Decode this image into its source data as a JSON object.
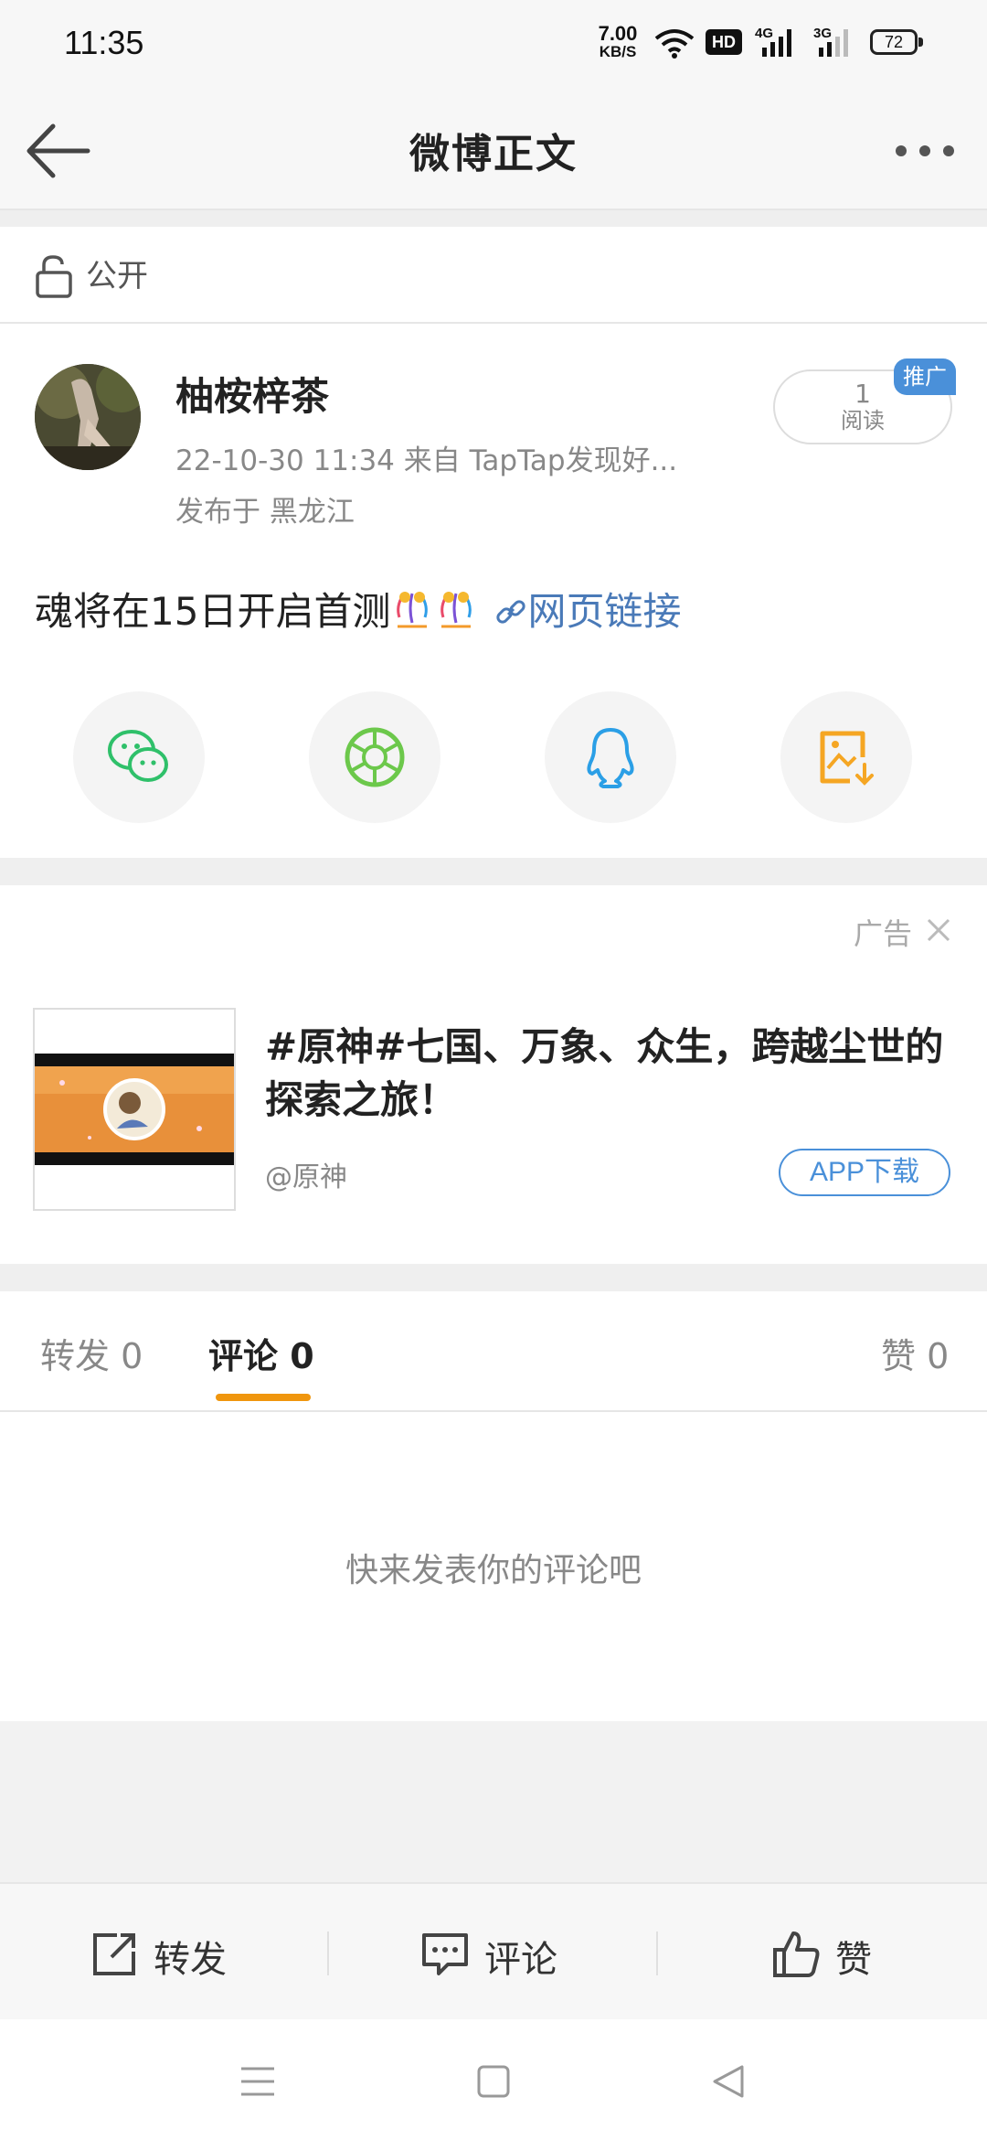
{
  "status_bar": {
    "time": "11:35",
    "net_speed_value": "7.00",
    "net_speed_unit": "KB/S",
    "hd_badge": "HD",
    "sig1_label": "4G",
    "sig2_label": "3G",
    "battery": "72"
  },
  "nav": {
    "title": "微博正文",
    "back_icon": "arrow-left-icon",
    "more_icon": "more-dots-icon"
  },
  "visibility": {
    "label": "公开"
  },
  "post": {
    "username": "柚桉梓茶",
    "meta": "22-10-30 11:34  来自 TapTap发现好...",
    "location": "发布于 黑龙江",
    "read_count": "1",
    "read_label": "阅读",
    "promo_tag": "推广",
    "text": "魂将在15日开启首测",
    "link_text": "网页链接"
  },
  "share": {
    "wechat_icon": "wechat-icon",
    "moments_icon": "moments-icon",
    "qq_icon": "qq-icon",
    "save_image_icon": "save-image-icon"
  },
  "ad": {
    "label": "广告",
    "title": "#原神#七国、万象、众生，跨越尘世的探索之旅！",
    "source": "@原神",
    "cta": "APP下载"
  },
  "tabs": {
    "reposts": "转发 0",
    "comments": "评论 0",
    "likes": "赞 0"
  },
  "empty_state": "快来发表你的评论吧",
  "toolbar": {
    "repost": "转发",
    "comment": "评论",
    "like": "赞"
  },
  "colors": {
    "accent_orange": "#f0960e",
    "link_blue": "#4a7ab8",
    "promo_blue": "#4a90d9",
    "wechat_green": "#2fc06a",
    "moments_green": "#6cc84b",
    "qq_blue": "#2b9fe6",
    "save_orange": "#f5a623"
  }
}
